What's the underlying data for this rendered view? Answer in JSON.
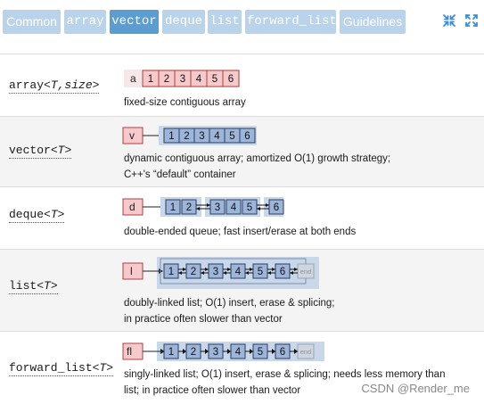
{
  "tabs": [
    {
      "label": "Common",
      "mono": false,
      "active": false
    },
    {
      "label": "array",
      "mono": true,
      "active": false
    },
    {
      "label": "vector",
      "mono": true,
      "active": true
    },
    {
      "label": "deque",
      "mono": true,
      "active": false
    },
    {
      "label": "list",
      "mono": true,
      "active": false
    },
    {
      "label": "forward_list",
      "mono": true,
      "active": false
    },
    {
      "label": "Guidelines",
      "mono": false,
      "active": false
    }
  ],
  "controls": {
    "collapse_icon": "collapse-arrows-icon",
    "expand_icon": "expand-arrows-icon",
    "accent_color": "#3b8ed6"
  },
  "containers": [
    {
      "name": "array",
      "params": "T,size",
      "diagram_label": "a",
      "cells": [
        "1",
        "2",
        "3",
        "4",
        "5",
        "6"
      ],
      "desc_lines": [
        "fixed-size contiguous array"
      ]
    },
    {
      "name": "vector",
      "params": "T",
      "diagram_label": "v",
      "cells": [
        "1",
        "2",
        "3",
        "4",
        "5",
        "6"
      ],
      "desc_lines": [
        "dynamic contiguous array; amortized O(1) growth strategy;",
        "C++'s “default” container"
      ]
    },
    {
      "name": "deque",
      "params": "T",
      "diagram_label": "d",
      "cells": [
        "1",
        "2",
        "3",
        "4",
        "5",
        "6"
      ],
      "desc_lines": [
        "double-ended queue; fast insert/erase at both ends"
      ]
    },
    {
      "name": "list",
      "params": "T",
      "diagram_label": "l",
      "cells": [
        "1",
        "2",
        "3",
        "4",
        "5",
        "6"
      ],
      "end_label": "end",
      "desc_lines": [
        "doubly-linked list; O(1) insert, erase & splicing;",
        "in practice often slower than vector"
      ]
    },
    {
      "name": "forward_list",
      "params": "T",
      "diagram_label": "fl",
      "cells": [
        "1",
        "2",
        "3",
        "4",
        "5",
        "6"
      ],
      "end_label": "end",
      "desc_lines": [
        "singly-linked list; O(1) insert, erase & splicing; needs less memory than",
        "list; in practice often slower than vector"
      ]
    }
  ],
  "watermark": "CSDN @Render_me",
  "colors": {
    "tab": "#b9d4ea",
    "tab_active": "#5b9dd0",
    "array_cell": "#f6c9cb",
    "node_cell": "#9db5d8",
    "node_bg": "#c9d7ea",
    "end_cell": "#cfd6df"
  }
}
